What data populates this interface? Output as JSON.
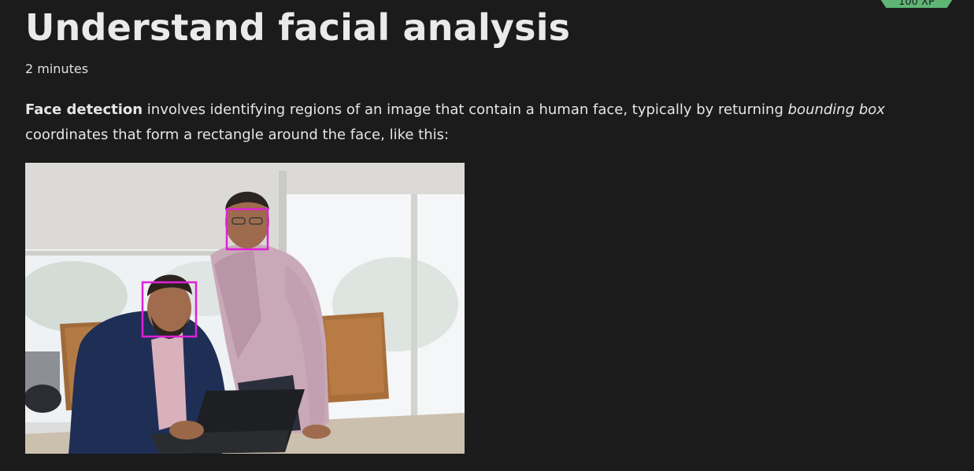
{
  "badge": {
    "label": "100 XP"
  },
  "unit": {
    "title": "Understand facial analysis",
    "duration": "2 minutes"
  },
  "content": {
    "term": "Face detection",
    "text_1": " involves identifying regions of an image that contain a human face, typically by returning ",
    "emphasis": "bounding box",
    "text_2": " coordinates that form a rectangle around the face, like this:"
  },
  "colors": {
    "background": "#1b1b1b",
    "bounding_box": "#e020d8",
    "badge": "#5fb574"
  }
}
